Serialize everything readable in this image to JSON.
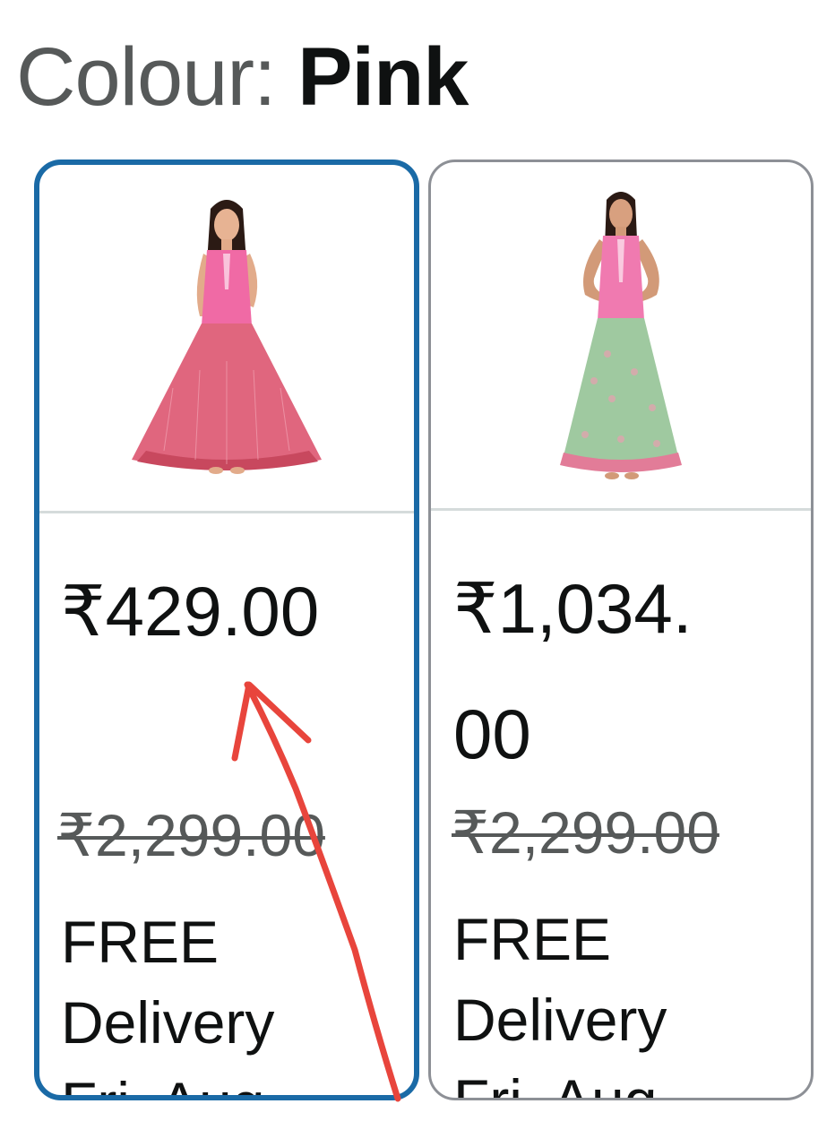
{
  "colour": {
    "label": "Colour: ",
    "value": "Pink"
  },
  "options": [
    {
      "price": "₹429.00",
      "mrp": "₹2,299.00",
      "delivery_line1": "FREE",
      "delivery_line2": "Delivery",
      "delivery_line3": "Fri, Aug",
      "selected": true,
      "skirt_color": "#e0667e",
      "top_color": "#f06aa5"
    },
    {
      "price": "₹1,034.00",
      "mrp": "₹2,299.00",
      "delivery_line1": "FREE",
      "delivery_line2": "Delivery",
      "delivery_line3": "Fri, Aug",
      "selected": false,
      "skirt_color": "#9fc9a0",
      "top_color": "#f07ab0"
    }
  ],
  "colors": {
    "selected_border": "#1a6aa6",
    "unselected_border": "#8d9096",
    "annotation": "#e8453c"
  }
}
